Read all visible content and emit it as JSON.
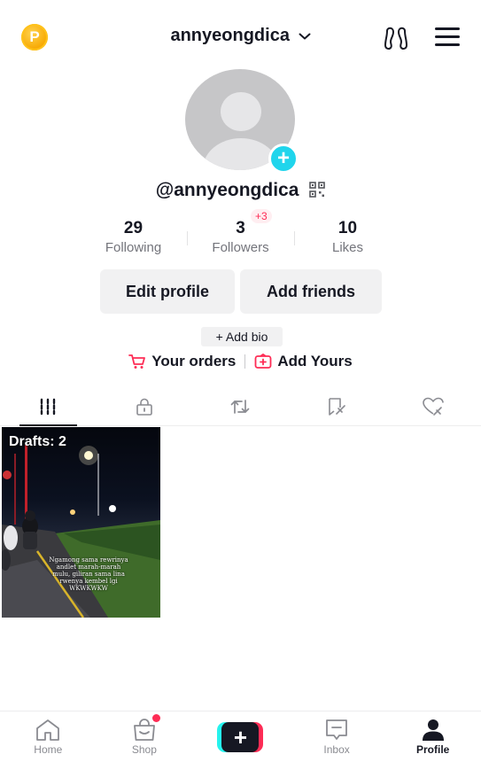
{
  "header": {
    "coin_letter": "P",
    "username": "annyeongdica",
    "icons": [
      "coin-icon",
      "chevron-down-icon",
      "footprint-icon",
      "menu-icon"
    ]
  },
  "profile": {
    "handle": "@annyeongdica",
    "avatar_add_symbol": "+"
  },
  "stats": [
    {
      "value": "29",
      "label": "Following"
    },
    {
      "value": "3",
      "label": "Followers",
      "badge": "+3"
    },
    {
      "value": "10",
      "label": "Likes"
    }
  ],
  "buttons": {
    "edit_profile": "Edit profile",
    "add_friends": "Add friends",
    "add_bio": "+ Add bio"
  },
  "links": {
    "orders": "Your orders",
    "add_yours": "Add Yours"
  },
  "tabs": [
    {
      "icon": "videos-grid-icon",
      "active": true
    },
    {
      "icon": "lock-icon",
      "active": false
    },
    {
      "icon": "repost-icon",
      "active": false
    },
    {
      "icon": "bookmark-icon",
      "active": false
    },
    {
      "icon": "liked-heart-icon",
      "active": false
    }
  ],
  "drafts": {
    "label": "Drafts: 2",
    "caption": "Ngamong sama rewrinya andlet marah-marah mulu, giliran sama lina rwenya kembel lgi WKWKWKW"
  },
  "bottom_nav": [
    {
      "label": "Home"
    },
    {
      "label": "Shop"
    },
    {
      "label": "",
      "create_symbol": "+"
    },
    {
      "label": "Inbox"
    },
    {
      "label": "Profile"
    }
  ],
  "colors": {
    "accent_red": "#fe2c55",
    "accent_cyan": "#25f4ee",
    "avatar_plus": "#20d5ec",
    "coin": "#f7a700",
    "text": "#161823",
    "muted": "#73747b"
  }
}
